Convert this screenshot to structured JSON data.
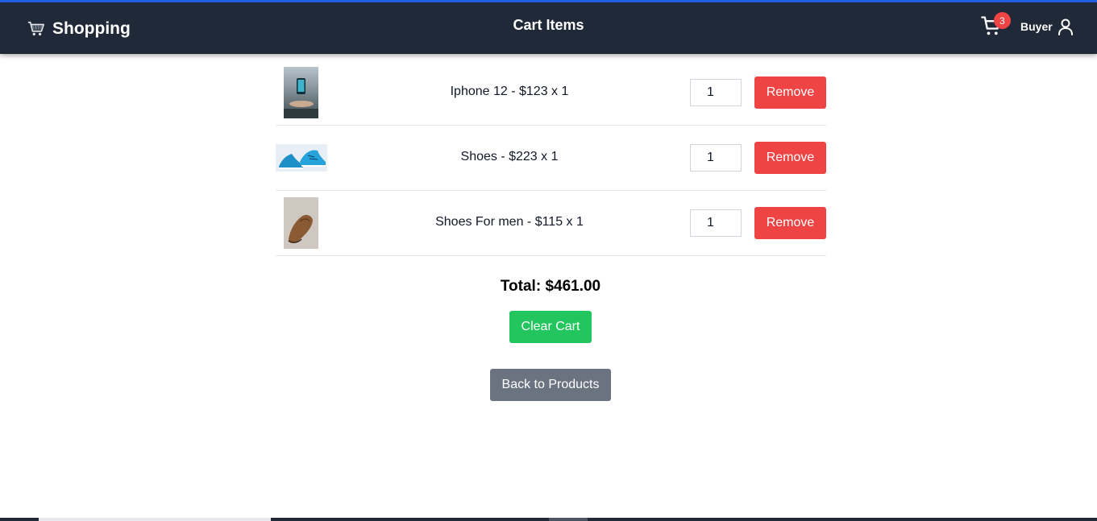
{
  "header": {
    "brand": "Shopping",
    "title": "Cart Items",
    "cart_count": "3",
    "user_label": "Buyer"
  },
  "cart": {
    "items": [
      {
        "label": "Iphone 12 - $123 x 1",
        "quantity": "1",
        "remove_label": "Remove"
      },
      {
        "label": "Shoes - $223 x 1",
        "quantity": "1",
        "remove_label": "Remove"
      },
      {
        "label": "Shoes For men - $115 x 1",
        "quantity": "1",
        "remove_label": "Remove"
      }
    ],
    "total": "Total: $461.00",
    "clear_label": "Clear Cart",
    "back_label": "Back to Products"
  },
  "colors": {
    "navbar": "#1f2937",
    "danger": "#ef4444",
    "success": "#22c55e",
    "secondary": "#6b7280",
    "accent_line": "#2563eb"
  },
  "icons": {
    "brand": "shopping-cart-icon",
    "cart": "cart-icon",
    "user": "user-icon"
  }
}
